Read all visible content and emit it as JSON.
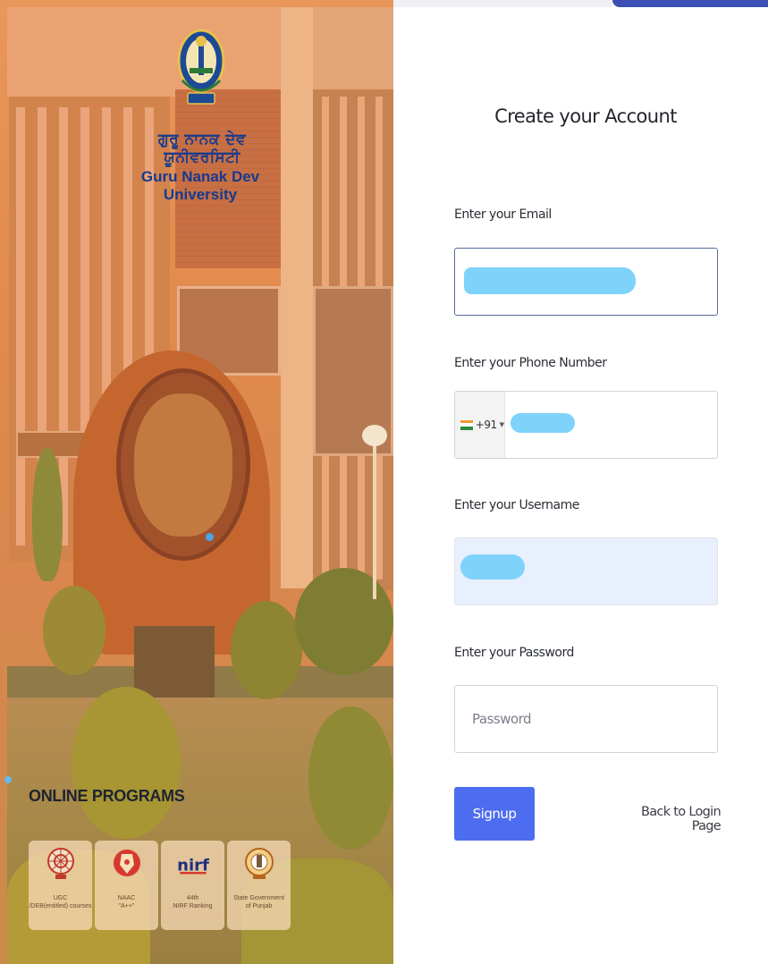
{
  "university": {
    "name_punjabi": "ਗੁਰੂ ਨਾਨਕ ਦੇਵ ਯੂਨੀਵਰਸਿਟੀ",
    "name_english": "Guru Nanak Dev University",
    "logo_icon": "university-crest-icon"
  },
  "programs": {
    "heading": "ONLINE PROGRAMS",
    "badges": [
      {
        "label": "UGC\n/DEB(entitled) courses",
        "icon": "ugc-emblem-icon"
      },
      {
        "label": "NAAC\n\"A++\"",
        "icon": "naac-emblem-icon"
      },
      {
        "label": "44th\nNIRF Ranking",
        "icon": "nirf-logo-icon",
        "logo_text": "nirf"
      },
      {
        "label": "State Government\nof Punjab",
        "icon": "punjab-govt-emblem-icon"
      }
    ]
  },
  "form": {
    "title": "Create your Account",
    "email_label": "Enter your Email",
    "phone_label": "Enter your Phone Number",
    "phone_code": "+91",
    "username_label": "Enter your Username",
    "password_label": "Enter your Password",
    "password_placeholder": "Password",
    "signup_label": "Signup",
    "back_label": "Back to Login Page"
  },
  "colors": {
    "primary_button": "#4d6df0",
    "university_text": "#163a8e",
    "redaction": "#7fd3fb",
    "autofill_bg": "#e8f0fe"
  }
}
